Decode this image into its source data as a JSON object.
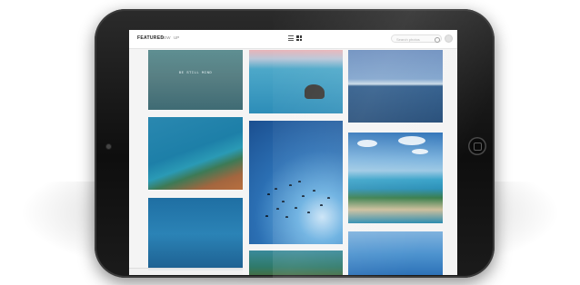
{
  "app": {
    "brand": "FEATURED",
    "nav": [
      "NEW",
      "UP"
    ]
  },
  "search": {
    "placeholder": "Search photos"
  },
  "tiles": [
    {
      "name": "tile-calm-sea",
      "caption": "BE STILL MIND"
    },
    {
      "name": "tile-rock-ocean",
      "caption": ""
    },
    {
      "name": "tile-horizon",
      "caption": ""
    },
    {
      "name": "tile-coastline",
      "caption": ""
    },
    {
      "name": "tile-birds-sky",
      "caption": ""
    },
    {
      "name": "tile-cliffs",
      "caption": ""
    },
    {
      "name": "tile-deep-blue",
      "caption": ""
    },
    {
      "name": "tile-aerial",
      "caption": ""
    },
    {
      "name": "tile-sky",
      "caption": ""
    }
  ],
  "icons": {
    "list_view": "list-view-icon",
    "grid_view": "grid-view-icon",
    "search": "search-icon",
    "avatar": "avatar-icon"
  }
}
